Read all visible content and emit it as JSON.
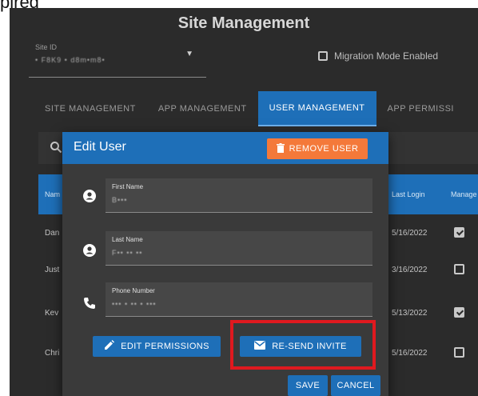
{
  "top_caption": "pired",
  "page": {
    "title": "Site Management"
  },
  "site_id": {
    "label": "Site ID",
    "value": "• F8K9 • d8m•m8•"
  },
  "migration": {
    "label": "Migration Mode Enabled"
  },
  "tabs": [
    {
      "label": "SITE MANAGEMENT"
    },
    {
      "label": "APP MANAGEMENT"
    },
    {
      "label": "USER MANAGEMENT"
    },
    {
      "label": "APP PERMISSI"
    }
  ],
  "table": {
    "headers": {
      "name": "Nam",
      "last_login": "Last Login",
      "manager": "Manage"
    },
    "rows": [
      {
        "name": "Dan",
        "date": "5/16/2022",
        "checked": true
      },
      {
        "name": "Just",
        "date": "3/16/2022",
        "checked": false
      },
      {
        "name": "Kev",
        "date": "5/13/2022",
        "checked": true
      },
      {
        "name": "Chri",
        "date": "5/16/2022",
        "checked": false
      }
    ]
  },
  "dialog": {
    "title": "Edit User",
    "remove_label": "REMOVE USER",
    "fields": [
      {
        "label": "First Name",
        "value": "B•••"
      },
      {
        "label": "Last Name",
        "value": "F•• •• ••"
      },
      {
        "label": "Phone Number",
        "value": "••• • •• • •••"
      }
    ],
    "edit_permissions_label": "EDIT PERMISSIONS",
    "resend_label": "RE-SEND INVITE",
    "save_label": "SAVE",
    "cancel_label": "CANCEL"
  },
  "colors": {
    "accent": "#1e6fb8",
    "remove": "#f4793a",
    "highlight": "#e0191f",
    "background": "#2b2b2b"
  }
}
